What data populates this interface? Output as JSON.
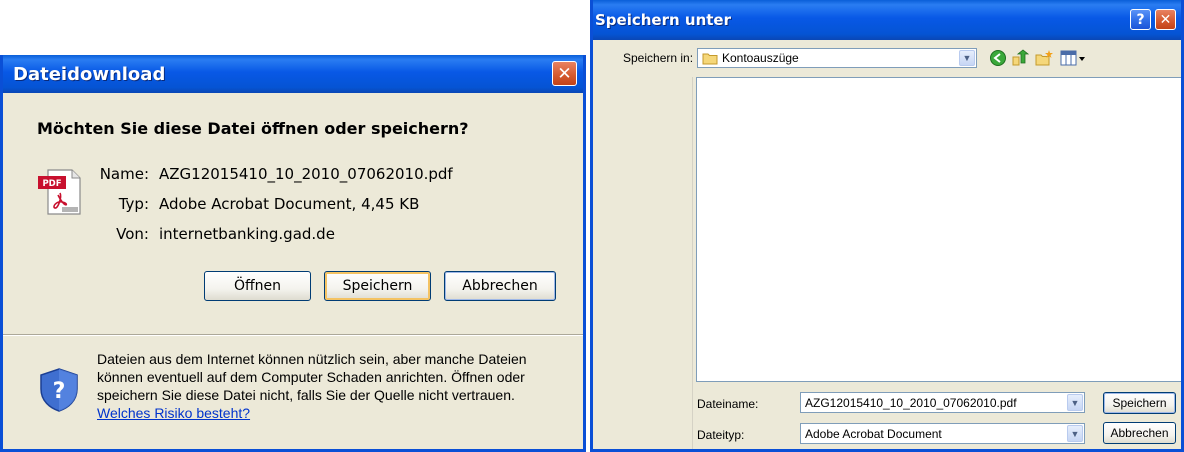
{
  "download_dialog": {
    "title": "Dateidownload",
    "question": "Möchten Sie diese Datei öffnen oder speichern?",
    "file_icon": "pdf-file-icon",
    "name_label": "Name:",
    "name_value": "AZG12015410_10_2010_07062010.pdf",
    "type_label": "Typ:",
    "type_value": "Adobe Acrobat Document, 4,45 KB",
    "from_label": "Von:",
    "from_value": "internetbanking.gad.de",
    "open_button": "Öffnen",
    "save_button": "Speichern",
    "cancel_button": "Abbrechen",
    "warning_icon": "security-shield-icon",
    "warning_text": "Dateien aus dem Internet können nützlich sein, aber manche Dateien können eventuell auf dem Computer Schaden anrichten. Öffnen oder speichern Sie diese Datei nicht, falls Sie der Quelle nicht vertrauen.",
    "risk_link": "Welches Risiko besteht?"
  },
  "save_dialog": {
    "title": "Speichern unter",
    "save_in_label": "Speichern in:",
    "save_in_value": "Kontoauszüge",
    "filename_label": "Dateiname:",
    "filename_value": "AZG12015410_10_2010_07062010.pdf",
    "filetype_label": "Dateityp:",
    "filetype_value": "Adobe Acrobat Document",
    "save_button": "Speichern",
    "cancel_button": "Abbrechen",
    "toolbar_icons": [
      "back-icon",
      "up-folder-icon",
      "new-folder-icon",
      "view-menu-icon"
    ]
  },
  "colors": {
    "titlebar_blue": "#0554d4",
    "dialog_bg": "#ece9d8",
    "close_red": "#d65b31",
    "link_blue": "#0033cc"
  }
}
